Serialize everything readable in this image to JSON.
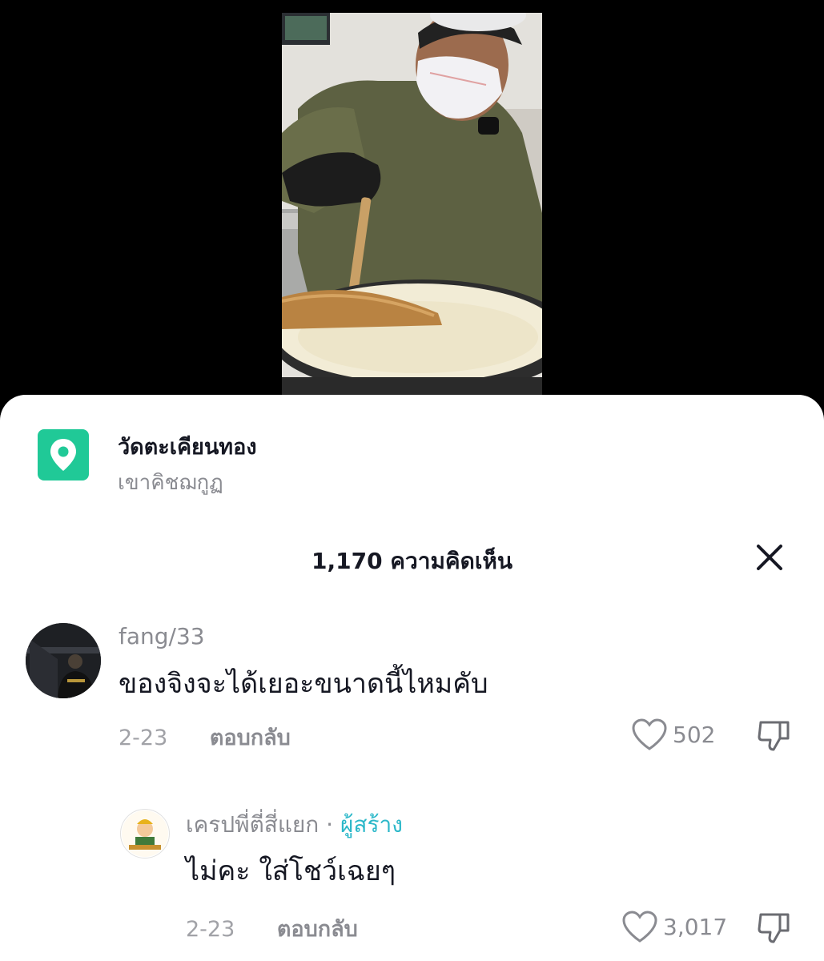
{
  "location": {
    "name": "วัดตะเคียนทอง",
    "subtitle": "เขาคิชฌกูฏ"
  },
  "comments_header": {
    "title": "1,170 ความคิดเห็น"
  },
  "comments": [
    {
      "username": "fang/33",
      "text": "ของจิงจะได้เยอะขนาดนี้ไหมคับ",
      "date": "2-23",
      "reply_label": "ตอบกลับ",
      "likes": "502"
    },
    {
      "username": "เครปพี่ตี่สี่แยก",
      "separator": " · ",
      "creator_label": "ผู้สร้าง",
      "text": "ไม่คะ ใส่โชว์เฉยๆ",
      "date": "2-23",
      "reply_label": "ตอบกลับ",
      "likes": "3,017"
    }
  ],
  "colors": {
    "location_icon_bg": "#20c997",
    "creator_tag": "#2cb8c9",
    "secondary_text": "#8a8b91"
  },
  "icons": [
    "location-pin-icon",
    "close-icon",
    "heart-icon",
    "dislike-icon"
  ]
}
